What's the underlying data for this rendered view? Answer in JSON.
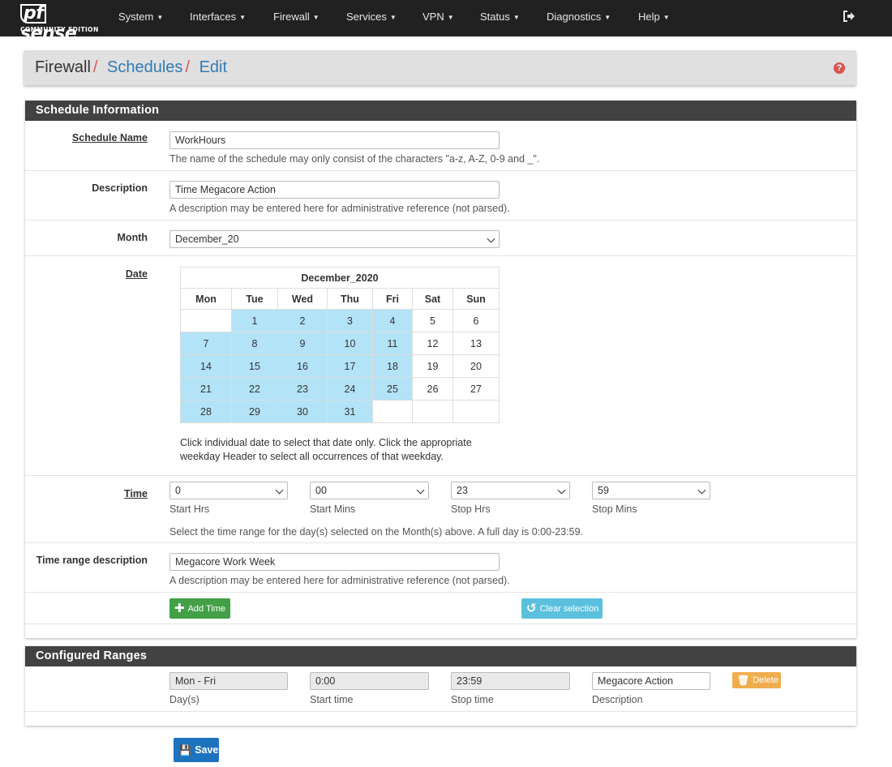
{
  "navbar": {
    "logo_text": "sense",
    "logo_pf": "pf",
    "logo_edition": "COMMUNITY EDITION",
    "menu": [
      "System",
      "Interfaces",
      "Firewall",
      "Services",
      "VPN",
      "Status",
      "Diagnostics",
      "Help"
    ]
  },
  "breadcrumb": {
    "root": "Firewall",
    "section": "Schedules",
    "page": "Edit"
  },
  "schedule_info": {
    "heading": "Schedule Information",
    "name_label": "Schedule Name",
    "name_value": "WorkHours",
    "name_help": "The name of the schedule may only consist of the characters \"a-z, A-Z, 0-9 and _\".",
    "desc_label": "Description",
    "desc_value": "Time Megacore Action",
    "desc_help": "A description may be entered here for administrative reference (not parsed).",
    "month_label": "Month",
    "month_value": "December_20",
    "date_label": "Date",
    "calendar": {
      "title": "December_2020",
      "weekdays": [
        "Mon",
        "Tue",
        "Wed",
        "Thu",
        "Fri",
        "Sat",
        "Sun"
      ],
      "weeks": [
        [
          "",
          "1",
          "2",
          "3",
          "4",
          "5",
          "6"
        ],
        [
          "7",
          "8",
          "9",
          "10",
          "11",
          "12",
          "13"
        ],
        [
          "14",
          "15",
          "16",
          "17",
          "18",
          "19",
          "20"
        ],
        [
          "21",
          "22",
          "23",
          "24",
          "25",
          "26",
          "27"
        ],
        [
          "28",
          "29",
          "30",
          "31",
          "",
          "",
          ""
        ]
      ],
      "selected_days": [
        "1",
        "2",
        "3",
        "4",
        "7",
        "8",
        "9",
        "10",
        "11",
        "14",
        "15",
        "16",
        "17",
        "18",
        "21",
        "22",
        "23",
        "24",
        "25",
        "28",
        "29",
        "30",
        "31"
      ],
      "help_line1": "Click individual date to select that date only. Click the appropriate",
      "help_line2": "weekday Header to select all occurrences of that weekday.",
      "selected_color": "#b3e3f7"
    },
    "time_label": "Time",
    "start_hrs": "0",
    "start_mins": "00",
    "stop_hrs": "23",
    "stop_mins": "59",
    "start_hrs_label": "Start Hrs",
    "start_mins_label": "Start Mins",
    "stop_hrs_label": "Stop Hrs",
    "stop_mins_label": "Stop Mins",
    "time_help": "Select the time range for the day(s) selected on the Month(s) above. A full day is 0:00-23:59.",
    "range_desc_label": "Time range description",
    "range_desc_value": "Megacore Work Week",
    "range_desc_help": "A description may be entered here for administrative reference (not parsed).",
    "add_time_label": "Add Time",
    "clear_selection_label": "Clear selection"
  },
  "configured_ranges": {
    "heading": "Configured Ranges",
    "days_value": "Mon - Fri",
    "start_value": "0:00",
    "stop_value": "23:59",
    "desc_value": "Megacore Action",
    "days_label": "Day(s)",
    "start_label": "Start time",
    "stop_label": "Stop time",
    "desc_label": "Description",
    "delete_label": "Delete"
  },
  "save_label": "Save",
  "colors": {
    "navbar": "#212121",
    "panel_heading": "#424242",
    "link": "#337ab7",
    "danger": "#d9534f",
    "success": "#43a047",
    "info": "#5bc0de",
    "warning": "#f0ad4e",
    "primary": "#1e73be"
  }
}
